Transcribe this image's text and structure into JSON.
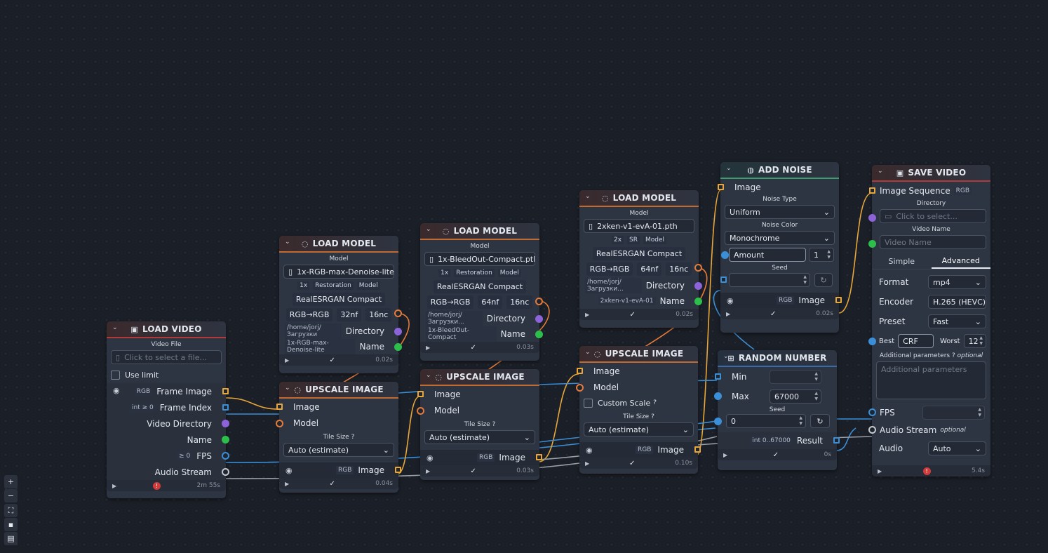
{
  "colors": {
    "image": "#e8a73a",
    "model": "#e47b3a",
    "directory": "#8d63d9",
    "name": "#2cbf4a",
    "number": "#3a8fd8",
    "audio": "#c4c8cf",
    "error": "#d13b3b"
  },
  "load_video": {
    "title": "LOAD VIDEO",
    "video_file_label": "Video File",
    "video_file_placeholder": "Click to select a file...",
    "use_limit": "Use limit",
    "outputs": [
      {
        "tag": "RGB",
        "label": "Frame Image"
      },
      {
        "tag": "int ≥ 0",
        "label": "Frame Index"
      },
      {
        "tag": "",
        "label": "Video Directory"
      },
      {
        "tag": "",
        "label": "Name"
      },
      {
        "tag": "≥ 0",
        "label": "FPS"
      },
      {
        "tag": "",
        "label": "Audio Stream"
      }
    ],
    "time": "2m 55s"
  },
  "load_model_1": {
    "title": "LOAD MODEL",
    "model_label": "Model",
    "model_file": "1x-RGB-max-Denoise-lite....",
    "tags": [
      "1x",
      "Restoration",
      "Model"
    ],
    "arch": "RealESRGAN Compact",
    "specs": [
      "RGB→RGB",
      "32nf",
      "16nc"
    ],
    "directory_value": "/home/jorj/Загрузки",
    "directory_label": "Directory",
    "name_value": "1x-RGB-max-Denoise-lite",
    "name_label": "Name",
    "time": "0.02s"
  },
  "load_model_2": {
    "title": "LOAD MODEL",
    "model_label": "Model",
    "model_file": "1x-BleedOut-Compact.pth",
    "tags": [
      "1x",
      "Restoration",
      "Model"
    ],
    "arch": "RealESRGAN Compact",
    "specs": [
      "RGB→RGB",
      "64nf",
      "16nc"
    ],
    "directory_value": "/home/jorj/Загрузки...",
    "directory_label": "Directory",
    "name_value": "1x-BleedOut-Compact",
    "name_label": "Name",
    "time": "0.03s"
  },
  "load_model_3": {
    "title": "LOAD MODEL",
    "model_label": "Model",
    "model_file": "2xken-v1-evA-01.pth",
    "tags": [
      "2x",
      "SR",
      "Model"
    ],
    "arch": "RealESRGAN Compact",
    "specs": [
      "RGB→RGB",
      "64nf",
      "16nc"
    ],
    "directory_value": "/home/jorj/Загрузки...",
    "directory_label": "Directory",
    "name_value": "2xken-v1-evA-01",
    "name_label": "Name",
    "time": "0.02s"
  },
  "upscale_1": {
    "title": "UPSCALE IMAGE",
    "image": "Image",
    "model": "Model",
    "tile_label": "Tile Size",
    "tile_value": "Auto (estimate)",
    "out_tag": "RGB",
    "out_label": "Image",
    "time": "0.04s"
  },
  "upscale_2": {
    "title": "UPSCALE IMAGE",
    "image": "Image",
    "model": "Model",
    "tile_label": "Tile Size",
    "tile_value": "Auto (estimate)",
    "out_tag": "RGB",
    "out_label": "Image",
    "time": "0.03s"
  },
  "upscale_3": {
    "title": "UPSCALE IMAGE",
    "image": "Image",
    "model": "Model",
    "custom_scale": "Custom Scale",
    "tile_label": "Tile Size",
    "tile_value": "Auto (estimate)",
    "out_tag": "RGB",
    "out_label": "Image",
    "time": "0.10s"
  },
  "add_noise": {
    "title": "ADD NOISE",
    "image": "Image",
    "noise_type_label": "Noise Type",
    "noise_type": "Uniform",
    "noise_color_label": "Noise Color",
    "noise_color": "Monochrome",
    "amount_label": "Amount",
    "amount_value": "1",
    "seed_label": "Seed",
    "out_tag": "RGB",
    "out_label": "Image",
    "time": "0.02s"
  },
  "random_number": {
    "title": "RANDOM NUMBER",
    "min_label": "Min",
    "max_label": "Max",
    "max_value": "67000",
    "seed_label": "Seed",
    "seed_value": "0",
    "result_tag": "int 0..67000",
    "result_label": "Result",
    "time": "0s"
  },
  "save_video": {
    "title": "SAVE VIDEO",
    "image_seq": "Image Sequence",
    "image_seq_tag": "RGB",
    "directory_label": "Directory",
    "directory_placeholder": "Click to select...",
    "video_name_label": "Video Name",
    "video_name_placeholder": "Video Name",
    "tab_simple": "Simple",
    "tab_advanced": "Advanced",
    "format_label": "Format",
    "format_value": "mp4",
    "encoder_label": "Encoder",
    "encoder_value": "H.265 (HEVC)",
    "preset_label": "Preset",
    "preset_value": "Fast",
    "best_label": "Best",
    "crf_value": "CRF",
    "worst_label": "Worst",
    "worst_value": "12",
    "additional_label": "Additional parameters",
    "optional": "optional",
    "additional_placeholder": "Additional parameters",
    "fps_label": "FPS",
    "audio_stream_label": "Audio Stream",
    "audio_label": "Audio",
    "audio_value": "Auto",
    "time": "5.4s"
  },
  "controls": [
    "zoom-in",
    "zoom-out",
    "fit-view",
    "lock",
    "export"
  ]
}
